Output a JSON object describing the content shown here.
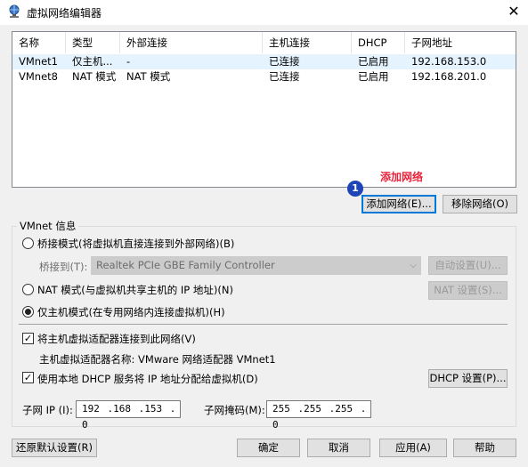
{
  "window": {
    "title": "虚拟网络编辑器",
    "close_glyph": "✕"
  },
  "table": {
    "columns": [
      "名称",
      "类型",
      "外部连接",
      "主机连接",
      "DHCP",
      "子网地址"
    ],
    "rows": [
      [
        "VMnet1",
        "仅主机...",
        "-",
        "已连接",
        "已启用",
        "192.168.153.0"
      ],
      [
        "VMnet8",
        "NAT 模式",
        "NAT 模式",
        "已连接",
        "已启用",
        "192.168.201.0"
      ]
    ],
    "selected_row": 0
  },
  "annotation": {
    "number": "1",
    "text": "添加网络"
  },
  "buttons": {
    "add_network": "添加网络(E)...",
    "remove_network": "移除网络(O)",
    "auto_settings": "自动设置(U)...",
    "nat_settings": "NAT 设置(S)...",
    "dhcp_settings": "DHCP 设置(P)...",
    "restore_defaults": "还原默认设置(R)",
    "ok": "确定",
    "cancel": "取消",
    "apply": "应用(A)",
    "help": "帮助"
  },
  "vmnet_info": {
    "title": "VMnet 信息",
    "bridged_label": "桥接模式(将虚拟机直接连接到外部网络)(B)",
    "bridge_to_label": "桥接到(T):",
    "bridge_to_value": "Realtek PCIe GBE Family Controller",
    "nat_label": "NAT 模式(与虚拟机共享主机的 IP 地址)(N)",
    "host_only_label": "仅主机模式(在专用网络内连接虚拟机)(H)",
    "selected_mode": "host_only",
    "connect_adapter_label": "将主机虚拟适配器连接到此网络(V)",
    "connect_adapter_checked": true,
    "adapter_name_label": "主机虚拟适配器名称: VMware 网络适配器 VMnet1",
    "use_dhcp_label": "使用本地 DHCP 服务将 IP 地址分配给虚拟机(D)",
    "use_dhcp_checked": true,
    "subnet_ip_label": "子网 IP (I):",
    "subnet_ip_value": "192 .168 .153 . 0",
    "subnet_mask_label": "子网掩码(M):",
    "subnet_mask_value": "255 .255 .255 . 0"
  },
  "colors": {
    "selection": "#e5f3ff",
    "focus_border": "#0078d7",
    "annotation_red": "#e6233a",
    "annotation_badge": "#1e44b8"
  }
}
